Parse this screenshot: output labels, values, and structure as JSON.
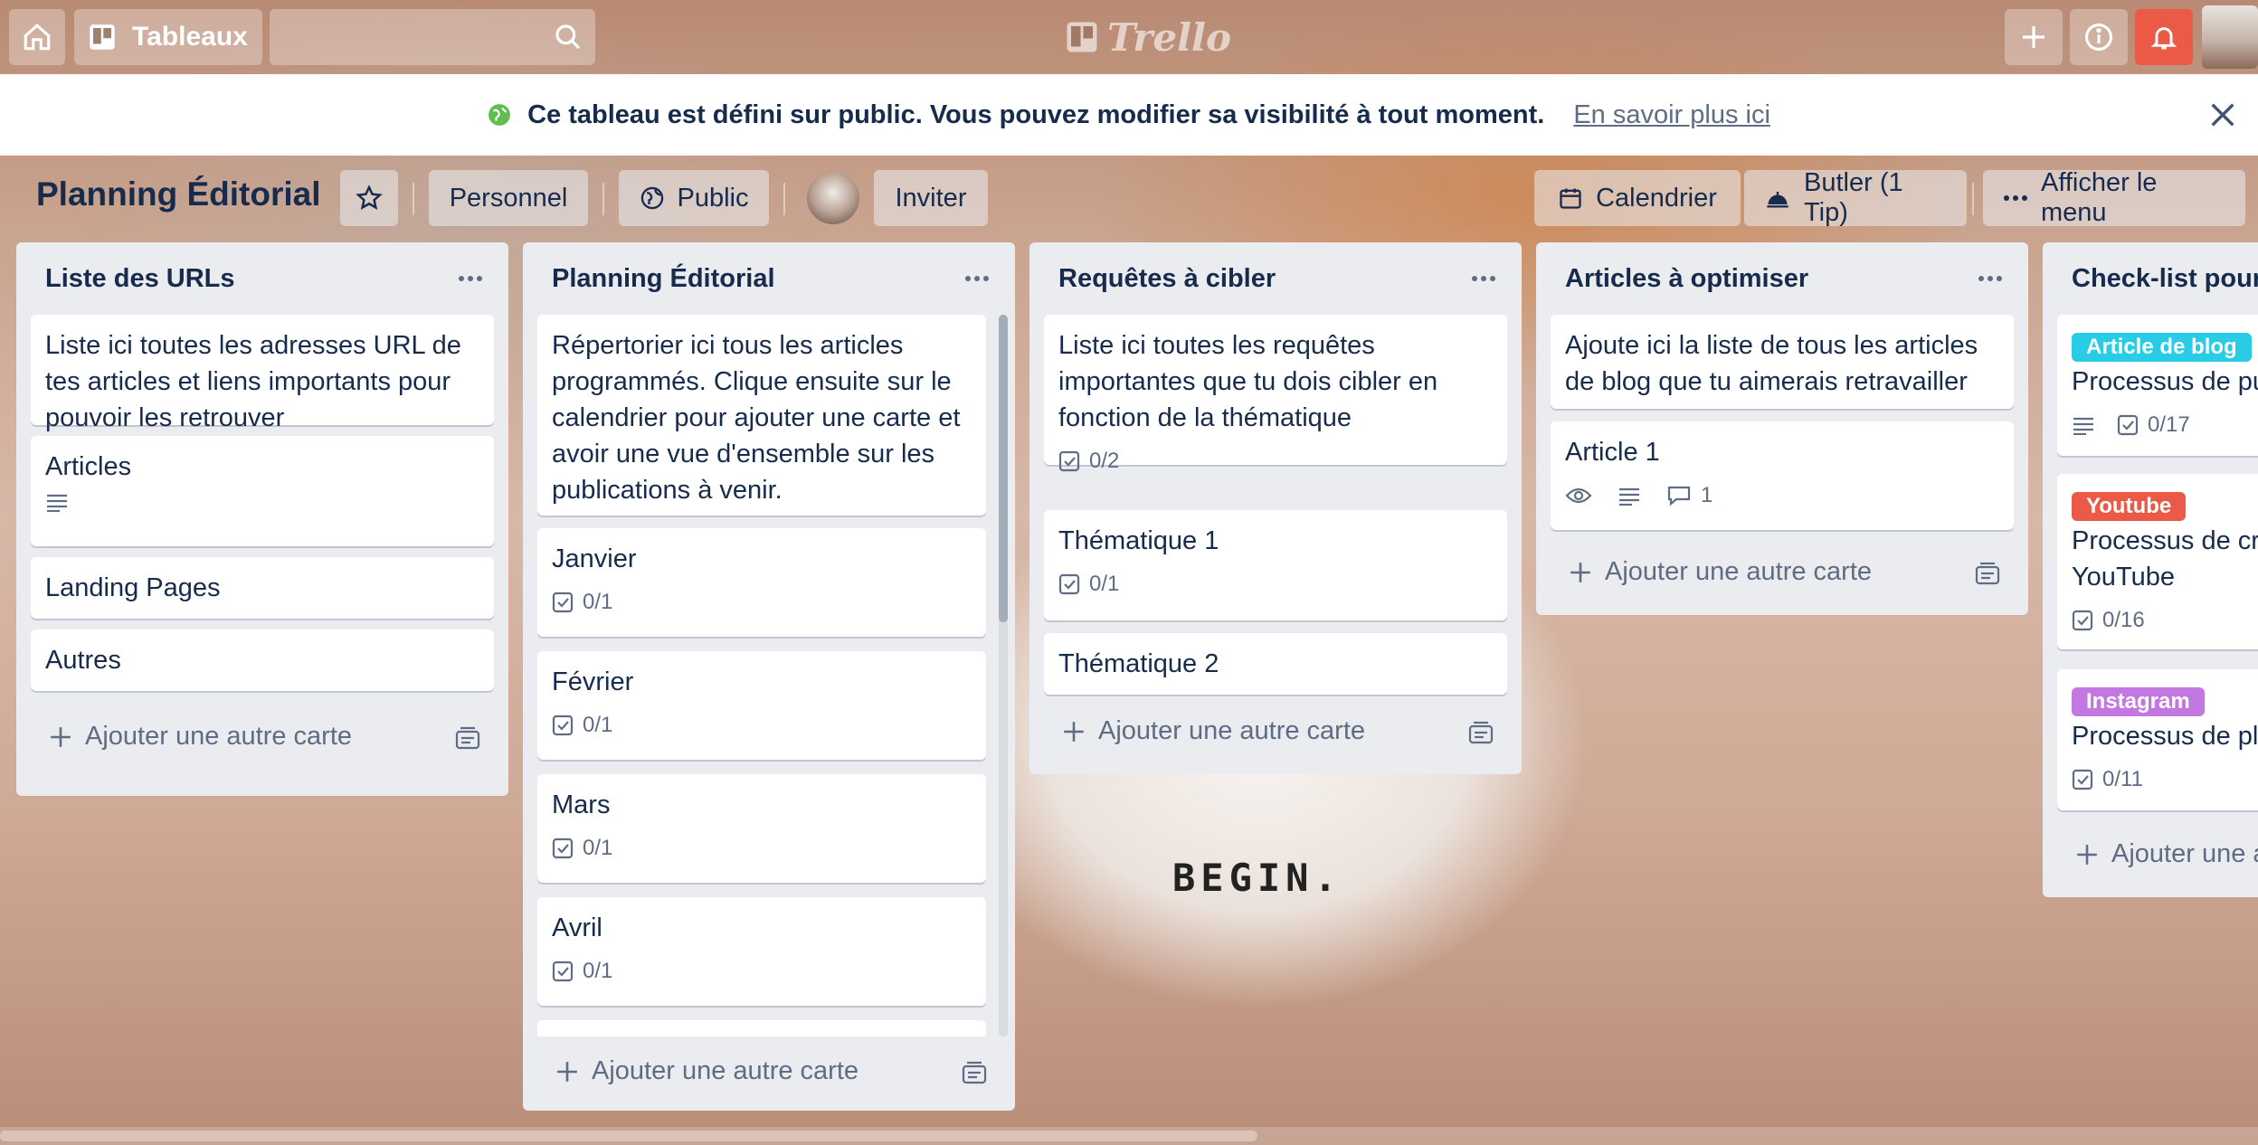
{
  "topbar": {
    "boards_label": "Tableaux",
    "logo_text": "Trello"
  },
  "banner": {
    "message": "Ce tableau est défini sur public. Vous pouvez modifier sa visibilité à tout moment.",
    "link": "En savoir plus ici"
  },
  "board_header": {
    "title": "Planning Éditorial",
    "personal": "Personnel",
    "visibility": "Public",
    "invite": "Inviter",
    "calendar": "Calendrier",
    "butler": "Butler (1 Tip)",
    "menu": "Afficher le menu"
  },
  "lists": [
    {
      "title": "Liste des URLs",
      "add_card": "Ajouter une autre carte",
      "cards": [
        {
          "text": "Liste ici toutes les adresses URL de tes articles et liens importants pour pouvoir les retrouver"
        },
        {
          "text": "Articles",
          "has_description": true
        },
        {
          "text": "Landing Pages"
        },
        {
          "text": "Autres"
        }
      ]
    },
    {
      "title": "Planning Éditorial",
      "add_card": "Ajouter une autre carte",
      "cards": [
        {
          "text": "Répertorier ici tous les articles programmés. Clique ensuite sur le calendrier pour ajouter une carte et avoir une vue d'ensemble sur les publications à venir."
        },
        {
          "text": "Janvier",
          "checklist": "0/1"
        },
        {
          "text": "Février",
          "checklist": "0/1"
        },
        {
          "text": "Mars",
          "checklist": "0/1"
        },
        {
          "text": "Avril",
          "checklist": "0/1"
        }
      ]
    },
    {
      "title": "Requêtes à cibler",
      "add_card": "Ajouter une autre carte",
      "cards": [
        {
          "text": "Liste ici toutes les requêtes importantes que tu dois cibler en fonction de la thématique",
          "checklist": "0/2"
        },
        {
          "text": "Thématique 1",
          "checklist": "0/1"
        },
        {
          "text": "Thématique 2"
        }
      ]
    },
    {
      "title": "Articles à optimiser",
      "add_card": "Ajouter une autre carte",
      "cards": [
        {
          "text": "Ajoute ici la liste de tous les articles de blog que tu aimerais retravailler"
        },
        {
          "text": "Article 1",
          "comments": "1"
        }
      ]
    },
    {
      "title": "Check-list pour",
      "add_card": "Ajouter une a",
      "cards": [
        {
          "label": "Article de blog",
          "label_color": "#29cce5",
          "text": "Processus de pu",
          "checklist": "0/17"
        },
        {
          "label": "Youtube",
          "label_color": "#eb5a46",
          "text": "Processus de cr YouTube",
          "checklist": "0/16"
        },
        {
          "label": "Instagram",
          "label_color": "#c377e0",
          "text": "Processus de pl",
          "checklist": "0/11"
        }
      ]
    }
  ],
  "background_text": "BEGIN.",
  "colors": {
    "list_bg": "#ebecf0",
    "text": "#172b4d",
    "muted": "#5e6c84",
    "notification": "#eb5a46",
    "public_globe": "#61bd4f"
  }
}
